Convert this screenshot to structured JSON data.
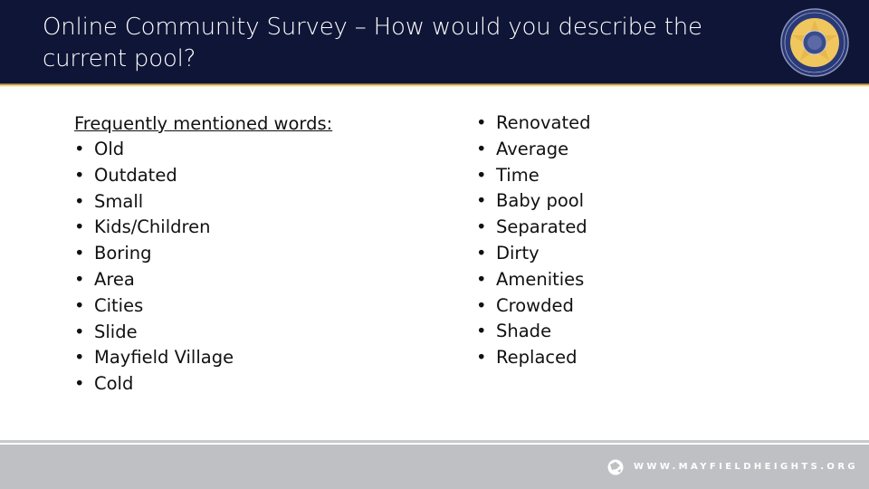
{
  "header": {
    "title": "Online Community Survey – How would you describe the current pool?",
    "logo": "city-of-mayfield-heights-ohio-seal",
    "colors": {
      "background": "#0f1536",
      "accent_gold": "#f2d98a"
    }
  },
  "left_column": {
    "heading": "Frequently mentioned words:",
    "items": [
      "Old",
      "Outdated",
      "Small",
      "Kids/Children",
      "Boring",
      "Area",
      "Cities",
      "Slide",
      "Mayfield Village",
      "Cold"
    ]
  },
  "right_column": {
    "items": [
      "Renovated",
      "Average",
      "Time",
      "Baby pool",
      "Separated",
      "Dirty",
      "Amenities",
      "Crowded",
      "Shade",
      "Replaced"
    ]
  },
  "bullet": "•",
  "footer": {
    "url": "WWW.MAYFIELDHEIGHTS.ORG",
    "icon": "globe-icon",
    "colors": {
      "background": "#bfc0c3"
    }
  }
}
